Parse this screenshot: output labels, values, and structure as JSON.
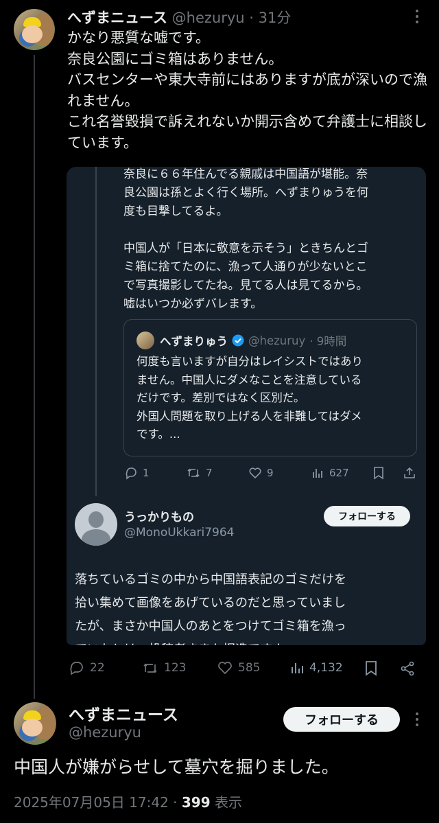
{
  "tweet1": {
    "display_name": "へずまニュース",
    "handle": "@hezuryu",
    "time": "· 31分",
    "text": "かなり悪質な嘘です。\n奈良公園にゴミ箱はありません。\nバスセンターや東大寺前にはありますが底が深いので漁れません。\nこれ名誉毀損で訴えれないか開示含めて弁護士に相談しています。",
    "stats": {
      "replies": "22",
      "reposts": "123",
      "likes": "585",
      "views": "4,132"
    }
  },
  "embed": {
    "top_text": "奈良に６６年住んでる親戚は中国語が堪能。奈\n良公園は孫とよく行く場所。へずまりゅうを何\n度も目撃してるよ。\n\n中国人が「日本に敬意を示そう」ときちんとゴ\nミ箱に捨てたのに、漁って人通りが少ないとこ\nで写真撮影してたね。見てる人は見てるから。\n嘘はいつか必ずバレます。",
    "quote": {
      "display_name": "へずまりゅう",
      "handle": "@hezuruy",
      "time": "· 9時間",
      "text": "何度も言いますが自分はレイシストではあり\nません。中国人にダメなことを注意している\nだけです。差別ではなく区別だ。\n外国人問題を取り上げる人を非難してはダメ\nです。..."
    },
    "stats": {
      "replies": "1",
      "reposts": "7",
      "likes": "9",
      "views": "627"
    },
    "reply": {
      "display_name": "うっかりもの",
      "handle": "@MonoUkkari7964",
      "follow_label": "フォローする",
      "text": "落ちているゴミの中から中国語表記のゴミだけを\n拾い集めて画像をあげているのだと思っていまし\nたが、まさか中国人のあとをつけてゴミ箱を漁っ\nていたとは。投稿者さまも捏造ですよ"
    }
  },
  "tweet2": {
    "display_name": "へずまニュース",
    "handle": "@hezuryu",
    "follow_label": "フォローする",
    "text": "中国人が嫌がらせして墓穴を掘りました。",
    "timestamp": "2025年07月05日 17:42 · ",
    "views_count": "399",
    "views_label": " 表示"
  },
  "colors": {
    "background": "#000000",
    "embed_bg": "#15202b",
    "muted": "#71767b",
    "verified": "#1d9bf0"
  }
}
